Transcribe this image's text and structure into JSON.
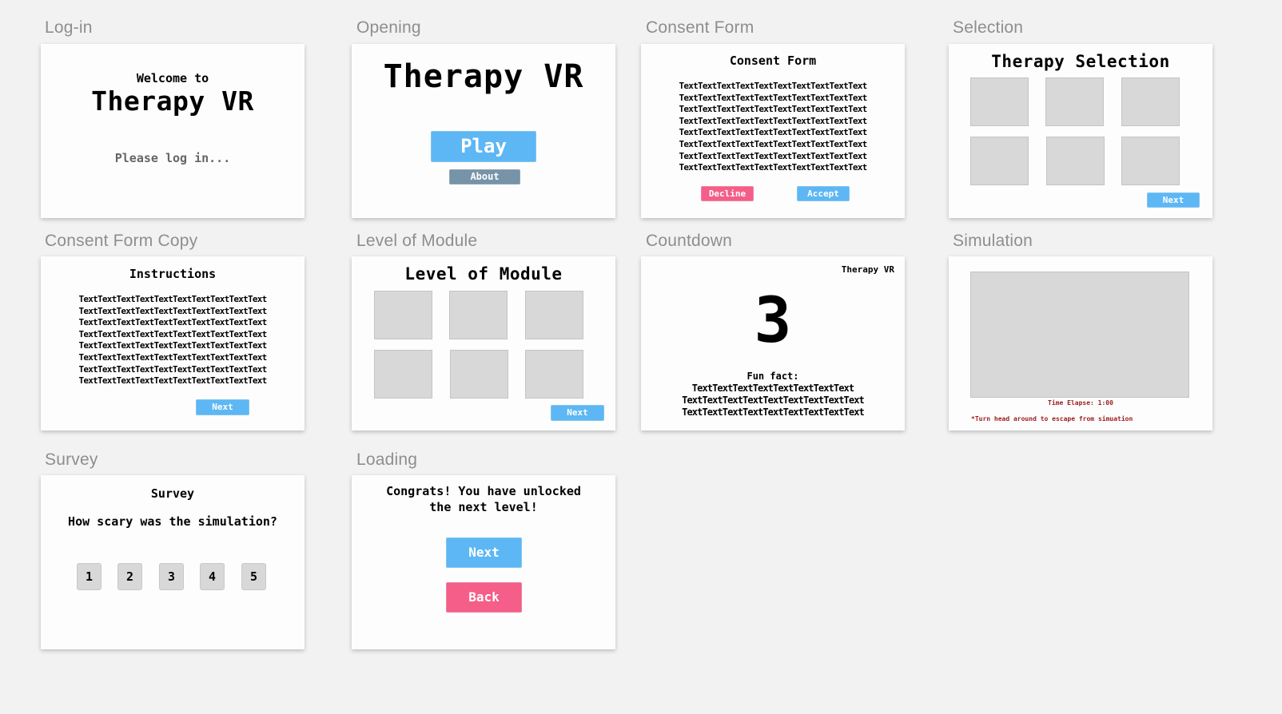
{
  "artboards": {
    "login": {
      "label": "Log-in",
      "welcome": "Welcome to",
      "title": "Therapy VR",
      "prompt": "Please log in..."
    },
    "opening": {
      "label": "Opening",
      "title": "Therapy VR",
      "play_label": "Play",
      "about_label": "About"
    },
    "consent": {
      "label": "Consent Form",
      "title": "Consent Form",
      "body_lines": [
        "TextTextTextTextTextTextTextTextTextText",
        "TextTextTextTextTextTextTextTextTextText",
        "TextTextTextTextTextTextTextTextTextText",
        "TextTextTextTextTextTextTextTextTextText",
        "TextTextTextTextTextTextTextTextTextText",
        "TextTextTextTextTextTextTextTextTextText",
        "TextTextTextTextTextTextTextTextTextText",
        "TextTextTextTextTextTextTextTextTextText"
      ],
      "decline_label": "Decline",
      "accept_label": "Accept"
    },
    "selection": {
      "label": "Selection",
      "title": "Therapy Selection",
      "next_label": "Next",
      "tile_count": 6
    },
    "consent_copy": {
      "label": "Consent Form Copy",
      "title": "Instructions",
      "body_lines": [
        "TextTextTextTextTextTextTextTextTextText",
        "TextTextTextTextTextTextTextTextTextText",
        "TextTextTextTextTextTextTextTextTextText",
        "TextTextTextTextTextTextTextTextTextText",
        "TextTextTextTextTextTextTextTextTextText",
        "TextTextTextTextTextTextTextTextTextText",
        "TextTextTextTextTextTextTextTextTextText",
        "TextTextTextTextTextTextTextTextTextText"
      ],
      "next_label": "Next"
    },
    "level": {
      "label": "Level of Module",
      "title": "Level of Module",
      "next_label": "Next",
      "tile_count": 6
    },
    "countdown": {
      "label": "Countdown",
      "brand": "Therapy VR",
      "count": "3",
      "fun_fact_label": "Fun fact:",
      "fact_lines": [
        "TextTextTextTextTextTextTextText",
        "TextTextTextTextTextTextTextTextText",
        "TextTextTextTextTextTextTextTextText"
      ]
    },
    "simulation": {
      "label": "Simulation",
      "time_elapsed": "Time Elapse: 1:00",
      "hint": "*Turn head around to escape from simuation"
    },
    "survey": {
      "label": "Survey",
      "title": "Survey",
      "question": "How scary was the simulation?",
      "options": [
        "1",
        "2",
        "3",
        "4",
        "5"
      ]
    },
    "loading": {
      "label": "Loading",
      "message_line1": "Congrats! You have unlocked",
      "message_line2": "the next level!",
      "next_label": "Next",
      "back_label": "Back"
    }
  },
  "colors": {
    "primary_blue": "#5db7f4",
    "danger_pink": "#f45e88",
    "secondary_slate": "#7793a8",
    "placeholder_gray": "#d8d8d8",
    "warning_red": "#9b1c1c",
    "canvas_bg": "#f2f2f2"
  }
}
